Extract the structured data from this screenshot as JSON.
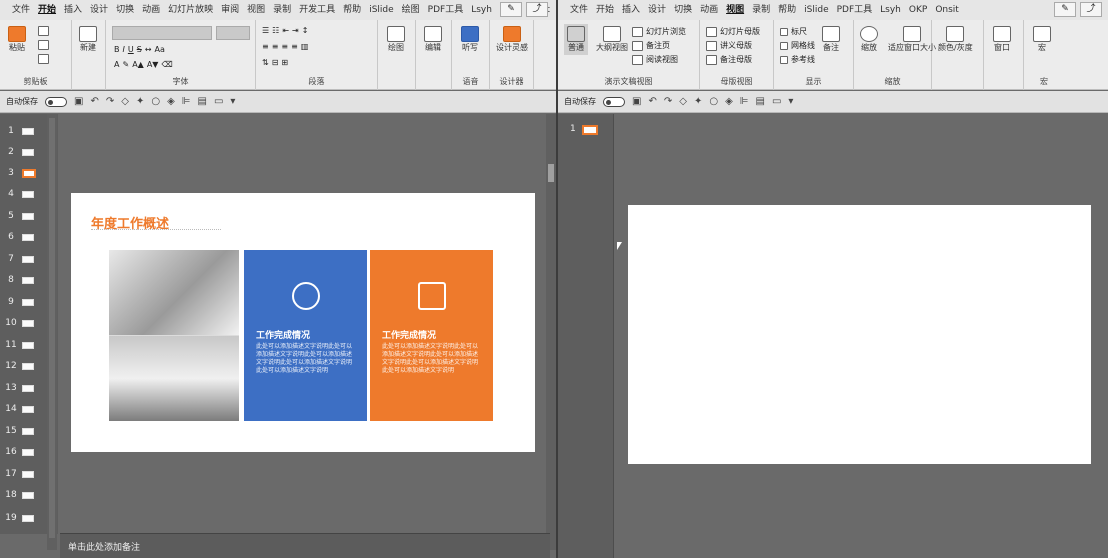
{
  "left": {
    "tabs": [
      "文件",
      "开始",
      "插入",
      "设计",
      "切换",
      "动画",
      "幻灯片放映",
      "审阅",
      "视图",
      "录制",
      "开发工具",
      "帮助",
      "iSlide",
      "绘图",
      "PDF工具",
      "Lsyh",
      "OKP",
      "Onsit"
    ],
    "active_tab": "开始",
    "groups": {
      "clipboard": "剪贴板",
      "font": "字体",
      "paragraph": "段落",
      "drawing": "绘图",
      "editing": "编辑",
      "voice": "语音",
      "designer": "设计器"
    },
    "buttons": {
      "paste": "粘贴",
      "new_slide": "新建",
      "drawing": "绘图",
      "editing": "编辑",
      "dictate": "听写",
      "design_ideas": "设计灵感"
    },
    "qat": {
      "autosave": "自动保存"
    },
    "thumbnails": [
      "1",
      "2",
      "3",
      "4",
      "5",
      "6",
      "7",
      "8",
      "9",
      "10",
      "11",
      "12",
      "13",
      "14",
      "15",
      "16",
      "17",
      "18",
      "19"
    ],
    "current_slide": "3",
    "notes_placeholder": "单击此处添加备注",
    "slide": {
      "title": "年度工作概述",
      "card1": {
        "title": "工作完成情况",
        "text": "此处可以添加描述文字说明此处可以添加描述文字说明此处可以添加描述文字说明此处可以添加描述文字说明此处可以添加描述文字说明"
      },
      "card2": {
        "title": "工作完成情况",
        "text": "此处可以添加描述文字说明此处可以添加描述文字说明此处可以添加描述文字说明此处可以添加描述文字说明此处可以添加描述文字说明"
      },
      "colors": {
        "blue": "#3d6fc4",
        "orange": "#ee7a2c"
      }
    }
  },
  "right": {
    "tabs": [
      "文件",
      "开始",
      "插入",
      "设计",
      "切换",
      "动画",
      "视图",
      "录制",
      "帮助",
      "iSlide",
      "PDF工具",
      "Lsyh",
      "OKP",
      "Onsit"
    ],
    "active_tab": "视图",
    "groups": {
      "presentation_views": "演示文稿视图",
      "master_views": "母版视图",
      "show": "显示",
      "zoom": "缩放",
      "color": "颜色",
      "window": "窗口",
      "macros": "宏"
    },
    "buttons": {
      "normal": "普通",
      "outline_view": "大纲视图",
      "slide_sorter": "幻灯片浏览",
      "notes_page": "备注页",
      "reading_view": "阅读视图",
      "slide_master": "幻灯片母版",
      "handout_master": "讲义母版",
      "notes_master": "备注母版",
      "ruler": "标尺",
      "gridlines": "网格线",
      "guides": "参考线",
      "notes": "备注",
      "zoom": "缩放",
      "fit_window": "适应窗口大小",
      "grayscale": "颜色/灰度",
      "window": "窗口",
      "macros": "宏"
    },
    "qat": {
      "autosave": "自动保存"
    },
    "thumbnails": [
      "1"
    ]
  }
}
